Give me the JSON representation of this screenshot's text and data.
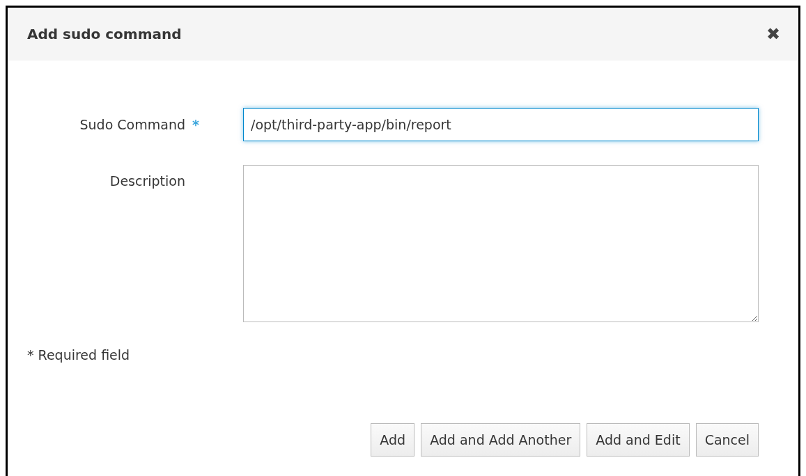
{
  "dialog": {
    "title": "Add sudo command",
    "close": "✖"
  },
  "fields": [
    {
      "kind": "input",
      "label": "Sudo Command",
      "required": true,
      "required_mark": "*",
      "value": "/opt/third-party-app/bin/report",
      "focused": true
    },
    {
      "kind": "textarea",
      "label": "Description",
      "required": false,
      "focused": false
    }
  ],
  "note": "* Required field",
  "buttons": [
    "Add",
    "Add and Add Another",
    "Add and Edit",
    "Cancel"
  ]
}
